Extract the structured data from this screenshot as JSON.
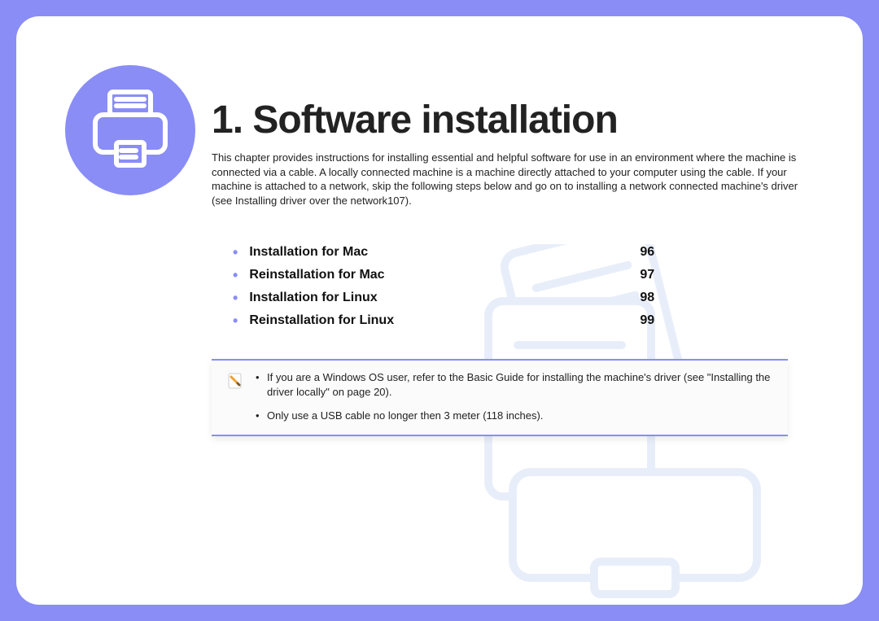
{
  "title": "1.  Software installation",
  "intro_p1": "This chapter provides instructions for installing essential and helpful software for use in an environment where the machine is connected via a cable. A locally connected machine is a machine directly attached to your computer using the cable. If your machine is attached to a network, skip the following steps below and go on to installing a network connected machine's driver (see ",
  "intro_link": "Installing driver over the network",
  "intro_p2": "107).",
  "toc": [
    {
      "label": "Installation for Mac",
      "page": "96"
    },
    {
      "label": "Reinstallation for Mac",
      "page": "97"
    },
    {
      "label": "Installation for Linux",
      "page": "98"
    },
    {
      "label": "Reinstallation for Linux",
      "page": "99"
    }
  ],
  "notes": [
    "If you are a Windows OS user, refer to the Basic Guide for installing the machine's driver (see \"Installing the driver locally\" on page 20).",
    "Only use a USB cable no longer then 3 meter (118 inches)."
  ]
}
